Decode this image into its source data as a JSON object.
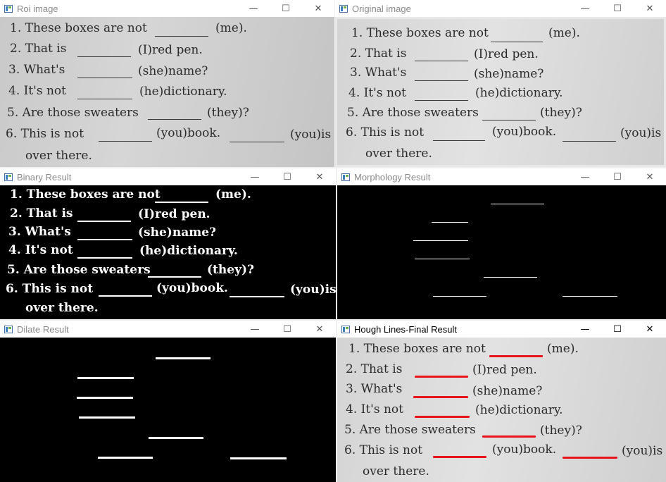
{
  "windows": {
    "roi": {
      "title": "Roi image"
    },
    "original": {
      "title": "Original image"
    },
    "binary": {
      "title": "Binary Result"
    },
    "morph": {
      "title": "Morphology Result"
    },
    "dilate": {
      "title": "Dilate Result"
    },
    "hough": {
      "title": "Hough Lines-Final Result"
    }
  },
  "controls": {
    "minimize": "—",
    "maximize": "☐",
    "close": "✕"
  },
  "worksheet": {
    "l1a": "1. These boxes are not",
    "l1b": "(me).",
    "l2a": "2. That is",
    "l2b": "(I)red pen.",
    "l3a": "3. What's",
    "l3b": "(she)name?",
    "l4a": "4. It's not",
    "l4b": "(he)dictionary.",
    "l5a": "5. Are those sweaters",
    "l5b": "(they)?",
    "l6a": "6. This is not",
    "l6b": "(you)book.",
    "l6c": "(you)is",
    "l7": "over there."
  },
  "colors": {
    "detected_line": "#e8141c"
  }
}
